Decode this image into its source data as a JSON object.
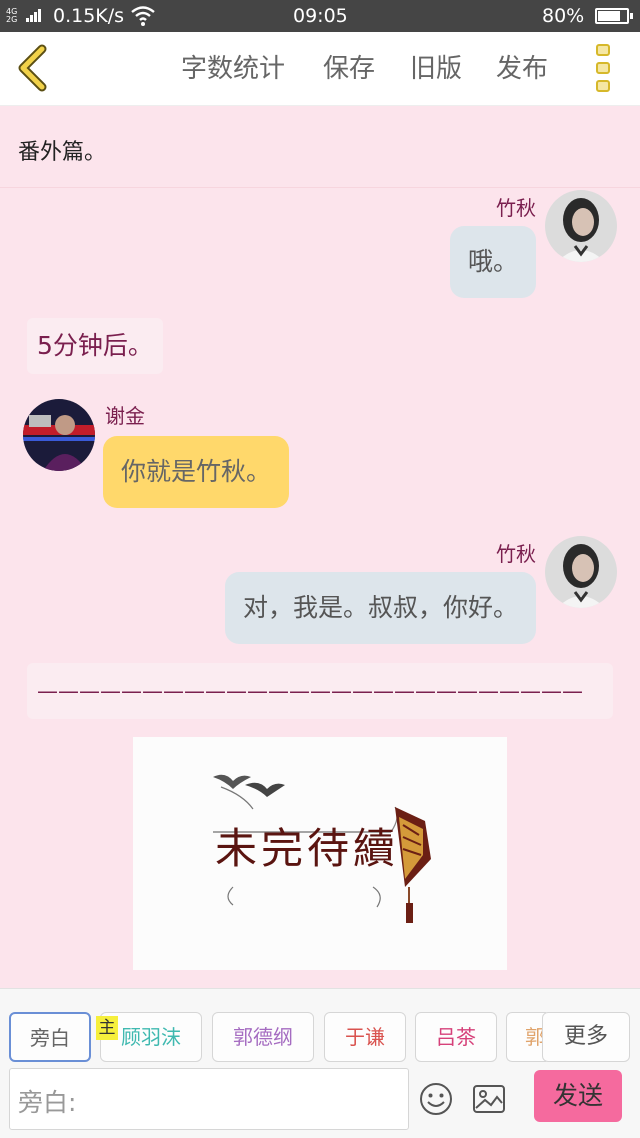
{
  "status": {
    "network_type": "4G\n2G",
    "speed": "0.15K/s",
    "time": "09:05",
    "battery_pct": "80%",
    "battery_level": 0.8
  },
  "toolbar": {
    "word_count": "字数统计",
    "save": "保存",
    "old_version": "旧版",
    "publish": "发布"
  },
  "chat": {
    "intro": "番外篇。",
    "messages": [
      {
        "speaker": "竹秋",
        "text": "哦。"
      },
      {
        "narration": "5分钟后。"
      },
      {
        "speaker": "谢金",
        "text": "你就是竹秋。"
      },
      {
        "speaker": "竹秋",
        "text": "对，我是。叔叔，你好。"
      },
      {
        "narration": "——————————————————————————"
      }
    ],
    "image_text": "未完待續"
  },
  "characters": {
    "items": [
      {
        "label": "旁白",
        "color": "#666666"
      },
      {
        "label": "顾羽沫",
        "color": "#3fb9b0"
      },
      {
        "label": "郭德纲",
        "color": "#a56cc1"
      },
      {
        "label": "于谦",
        "color": "#d9534f"
      },
      {
        "label": "吕茶",
        "color": "#d6417a"
      },
      {
        "label": "郭",
        "color": "#e0a36a"
      }
    ],
    "host_tag": "主",
    "more": "更多"
  },
  "composer": {
    "placeholder": "旁白:",
    "send": "发送"
  }
}
